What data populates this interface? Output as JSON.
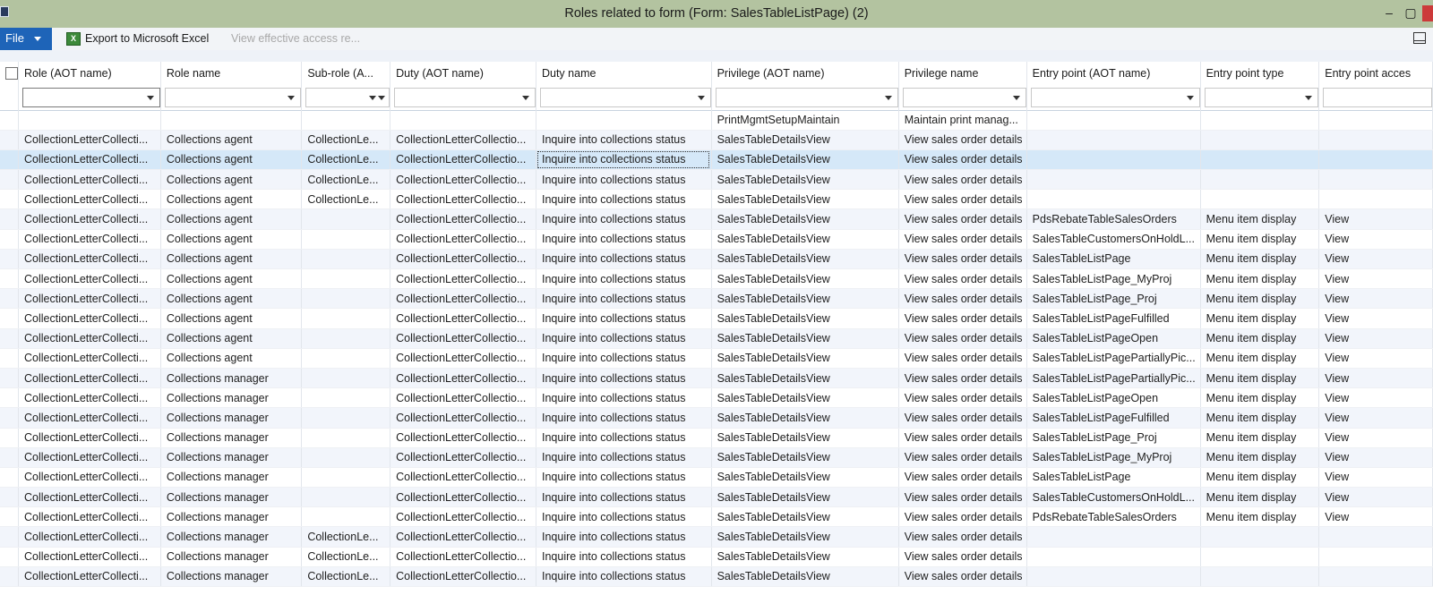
{
  "window": {
    "title": "Roles related to form (Form: SalesTableListPage) (2)",
    "min_glyph": "–",
    "max_glyph": "▢",
    "close_glyph": ""
  },
  "toolbar": {
    "file_label": "File",
    "export_label": "Export to Microsoft Excel",
    "excel_icon_text": "X",
    "view_access_label": "View effective access re..."
  },
  "columns": [
    "Role (AOT name)",
    "Role name",
    "Sub-role (A...",
    "Duty (AOT name)",
    "Duty name",
    "Privilege (AOT name)",
    "Privilege name",
    "Entry point (AOT name)",
    "Entry point type",
    "Entry point acces"
  ],
  "rows": [
    [
      "",
      "",
      "",
      "",
      "",
      "PrintMgmtSetupMaintain",
      "Maintain print manag...",
      "",
      "",
      ""
    ],
    [
      "CollectionLetterCollecti...",
      "Collections agent",
      "CollectionLe...",
      "CollectionLetterCollectio...",
      "Inquire into collections status",
      "SalesTableDetailsView",
      "View sales order details",
      "",
      "",
      ""
    ],
    [
      "CollectionLetterCollecti...",
      "Collections agent",
      "CollectionLe...",
      "CollectionLetterCollectio...",
      "Inquire into collections status",
      "SalesTableDetailsView",
      "View sales order details",
      "",
      "",
      ""
    ],
    [
      "CollectionLetterCollecti...",
      "Collections agent",
      "CollectionLe...",
      "CollectionLetterCollectio...",
      "Inquire into collections status",
      "SalesTableDetailsView",
      "View sales order details",
      "",
      "",
      ""
    ],
    [
      "CollectionLetterCollecti...",
      "Collections agent",
      "CollectionLe...",
      "CollectionLetterCollectio...",
      "Inquire into collections status",
      "SalesTableDetailsView",
      "View sales order details",
      "",
      "",
      ""
    ],
    [
      "CollectionLetterCollecti...",
      "Collections agent",
      "",
      "CollectionLetterCollectio...",
      "Inquire into collections status",
      "SalesTableDetailsView",
      "View sales order details",
      "PdsRebateTableSalesOrders",
      "Menu item display",
      "View"
    ],
    [
      "CollectionLetterCollecti...",
      "Collections agent",
      "",
      "CollectionLetterCollectio...",
      "Inquire into collections status",
      "SalesTableDetailsView",
      "View sales order details",
      "SalesTableCustomersOnHoldL...",
      "Menu item display",
      "View"
    ],
    [
      "CollectionLetterCollecti...",
      "Collections agent",
      "",
      "CollectionLetterCollectio...",
      "Inquire into collections status",
      "SalesTableDetailsView",
      "View sales order details",
      "SalesTableListPage",
      "Menu item display",
      "View"
    ],
    [
      "CollectionLetterCollecti...",
      "Collections agent",
      "",
      "CollectionLetterCollectio...",
      "Inquire into collections status",
      "SalesTableDetailsView",
      "View sales order details",
      "SalesTableListPage_MyProj",
      "Menu item display",
      "View"
    ],
    [
      "CollectionLetterCollecti...",
      "Collections agent",
      "",
      "CollectionLetterCollectio...",
      "Inquire into collections status",
      "SalesTableDetailsView",
      "View sales order details",
      "SalesTableListPage_Proj",
      "Menu item display",
      "View"
    ],
    [
      "CollectionLetterCollecti...",
      "Collections agent",
      "",
      "CollectionLetterCollectio...",
      "Inquire into collections status",
      "SalesTableDetailsView",
      "View sales order details",
      "SalesTableListPageFulfilled",
      "Menu item display",
      "View"
    ],
    [
      "CollectionLetterCollecti...",
      "Collections agent",
      "",
      "CollectionLetterCollectio...",
      "Inquire into collections status",
      "SalesTableDetailsView",
      "View sales order details",
      "SalesTableListPageOpen",
      "Menu item display",
      "View"
    ],
    [
      "CollectionLetterCollecti...",
      "Collections agent",
      "",
      "CollectionLetterCollectio...",
      "Inquire into collections status",
      "SalesTableDetailsView",
      "View sales order details",
      "SalesTableListPagePartiallyPic...",
      "Menu item display",
      "View"
    ],
    [
      "CollectionLetterCollecti...",
      "Collections manager",
      "",
      "CollectionLetterCollectio...",
      "Inquire into collections status",
      "SalesTableDetailsView",
      "View sales order details",
      "SalesTableListPagePartiallyPic...",
      "Menu item display",
      "View"
    ],
    [
      "CollectionLetterCollecti...",
      "Collections manager",
      "",
      "CollectionLetterCollectio...",
      "Inquire into collections status",
      "SalesTableDetailsView",
      "View sales order details",
      "SalesTableListPageOpen",
      "Menu item display",
      "View"
    ],
    [
      "CollectionLetterCollecti...",
      "Collections manager",
      "",
      "CollectionLetterCollectio...",
      "Inquire into collections status",
      "SalesTableDetailsView",
      "View sales order details",
      "SalesTableListPageFulfilled",
      "Menu item display",
      "View"
    ],
    [
      "CollectionLetterCollecti...",
      "Collections manager",
      "",
      "CollectionLetterCollectio...",
      "Inquire into collections status",
      "SalesTableDetailsView",
      "View sales order details",
      "SalesTableListPage_Proj",
      "Menu item display",
      "View"
    ],
    [
      "CollectionLetterCollecti...",
      "Collections manager",
      "",
      "CollectionLetterCollectio...",
      "Inquire into collections status",
      "SalesTableDetailsView",
      "View sales order details",
      "SalesTableListPage_MyProj",
      "Menu item display",
      "View"
    ],
    [
      "CollectionLetterCollecti...",
      "Collections manager",
      "",
      "CollectionLetterCollectio...",
      "Inquire into collections status",
      "SalesTableDetailsView",
      "View sales order details",
      "SalesTableListPage",
      "Menu item display",
      "View"
    ],
    [
      "CollectionLetterCollecti...",
      "Collections manager",
      "",
      "CollectionLetterCollectio...",
      "Inquire into collections status",
      "SalesTableDetailsView",
      "View sales order details",
      "SalesTableCustomersOnHoldL...",
      "Menu item display",
      "View"
    ],
    [
      "CollectionLetterCollecti...",
      "Collections manager",
      "",
      "CollectionLetterCollectio...",
      "Inquire into collections status",
      "SalesTableDetailsView",
      "View sales order details",
      "PdsRebateTableSalesOrders",
      "Menu item display",
      "View"
    ],
    [
      "CollectionLetterCollecti...",
      "Collections manager",
      "CollectionLe...",
      "CollectionLetterCollectio...",
      "Inquire into collections status",
      "SalesTableDetailsView",
      "View sales order details",
      "",
      "",
      ""
    ],
    [
      "CollectionLetterCollecti...",
      "Collections manager",
      "CollectionLe...",
      "CollectionLetterCollectio...",
      "Inquire into collections status",
      "SalesTableDetailsView",
      "View sales order details",
      "",
      "",
      ""
    ],
    [
      "CollectionLetterCollecti...",
      "Collections manager",
      "CollectionLe...",
      "CollectionLetterCollectio...",
      "Inquire into collections status",
      "SalesTableDetailsView",
      "View sales order details",
      "",
      "",
      ""
    ]
  ],
  "selected_row": 2,
  "focused_column": 4
}
